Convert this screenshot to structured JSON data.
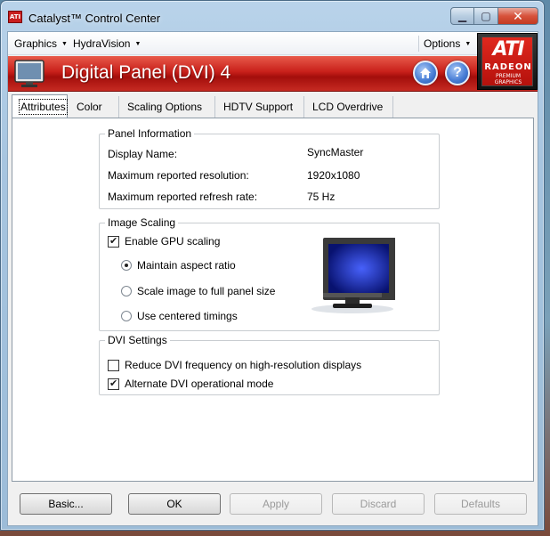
{
  "window": {
    "title": "Catalyst™ Control Center",
    "icon_text": "ATI"
  },
  "menubar": {
    "graphics": "Graphics",
    "hydravision": "HydraVision",
    "options": "Options"
  },
  "banner": {
    "title": "Digital Panel (DVI) 4",
    "home_icon": "home-icon",
    "help_icon": "help-icon",
    "logo": {
      "word": "ATI",
      "line1": "RADEON",
      "line2": "PREMIUM",
      "line3": "GRAPHICS"
    }
  },
  "tabs": [
    {
      "label": "Attributes",
      "active": true
    },
    {
      "label": "Color",
      "active": false
    },
    {
      "label": "Scaling Options",
      "active": false
    },
    {
      "label": "HDTV Support",
      "active": false
    },
    {
      "label": "LCD Overdrive",
      "active": false
    }
  ],
  "panel_info": {
    "title": "Panel Information",
    "rows": [
      {
        "label": "Display Name:",
        "value": "SyncMaster"
      },
      {
        "label": "Maximum reported resolution:",
        "value": "1920x1080"
      },
      {
        "label": "Maximum reported refresh rate:",
        "value": "75 Hz"
      }
    ]
  },
  "image_scaling": {
    "title": "Image Scaling",
    "enable_gpu": {
      "label": "Enable GPU scaling",
      "checked": true
    },
    "options": [
      {
        "label": "Maintain aspect ratio",
        "selected": true
      },
      {
        "label": "Scale image to full panel size",
        "selected": false
      },
      {
        "label": "Use centered timings",
        "selected": false
      }
    ]
  },
  "dvi_settings": {
    "title": "DVI Settings",
    "options": [
      {
        "label": "Reduce DVI frequency on high-resolution displays",
        "checked": false
      },
      {
        "label": "Alternate DVI operational mode",
        "checked": true
      }
    ]
  },
  "buttons": {
    "basic": "Basic...",
    "ok": "OK",
    "apply": "Apply",
    "discard": "Discard",
    "defaults": "Defaults"
  },
  "colors": {
    "banner_red": "#c8201a",
    "accent_blue": "#4a7fd6"
  }
}
